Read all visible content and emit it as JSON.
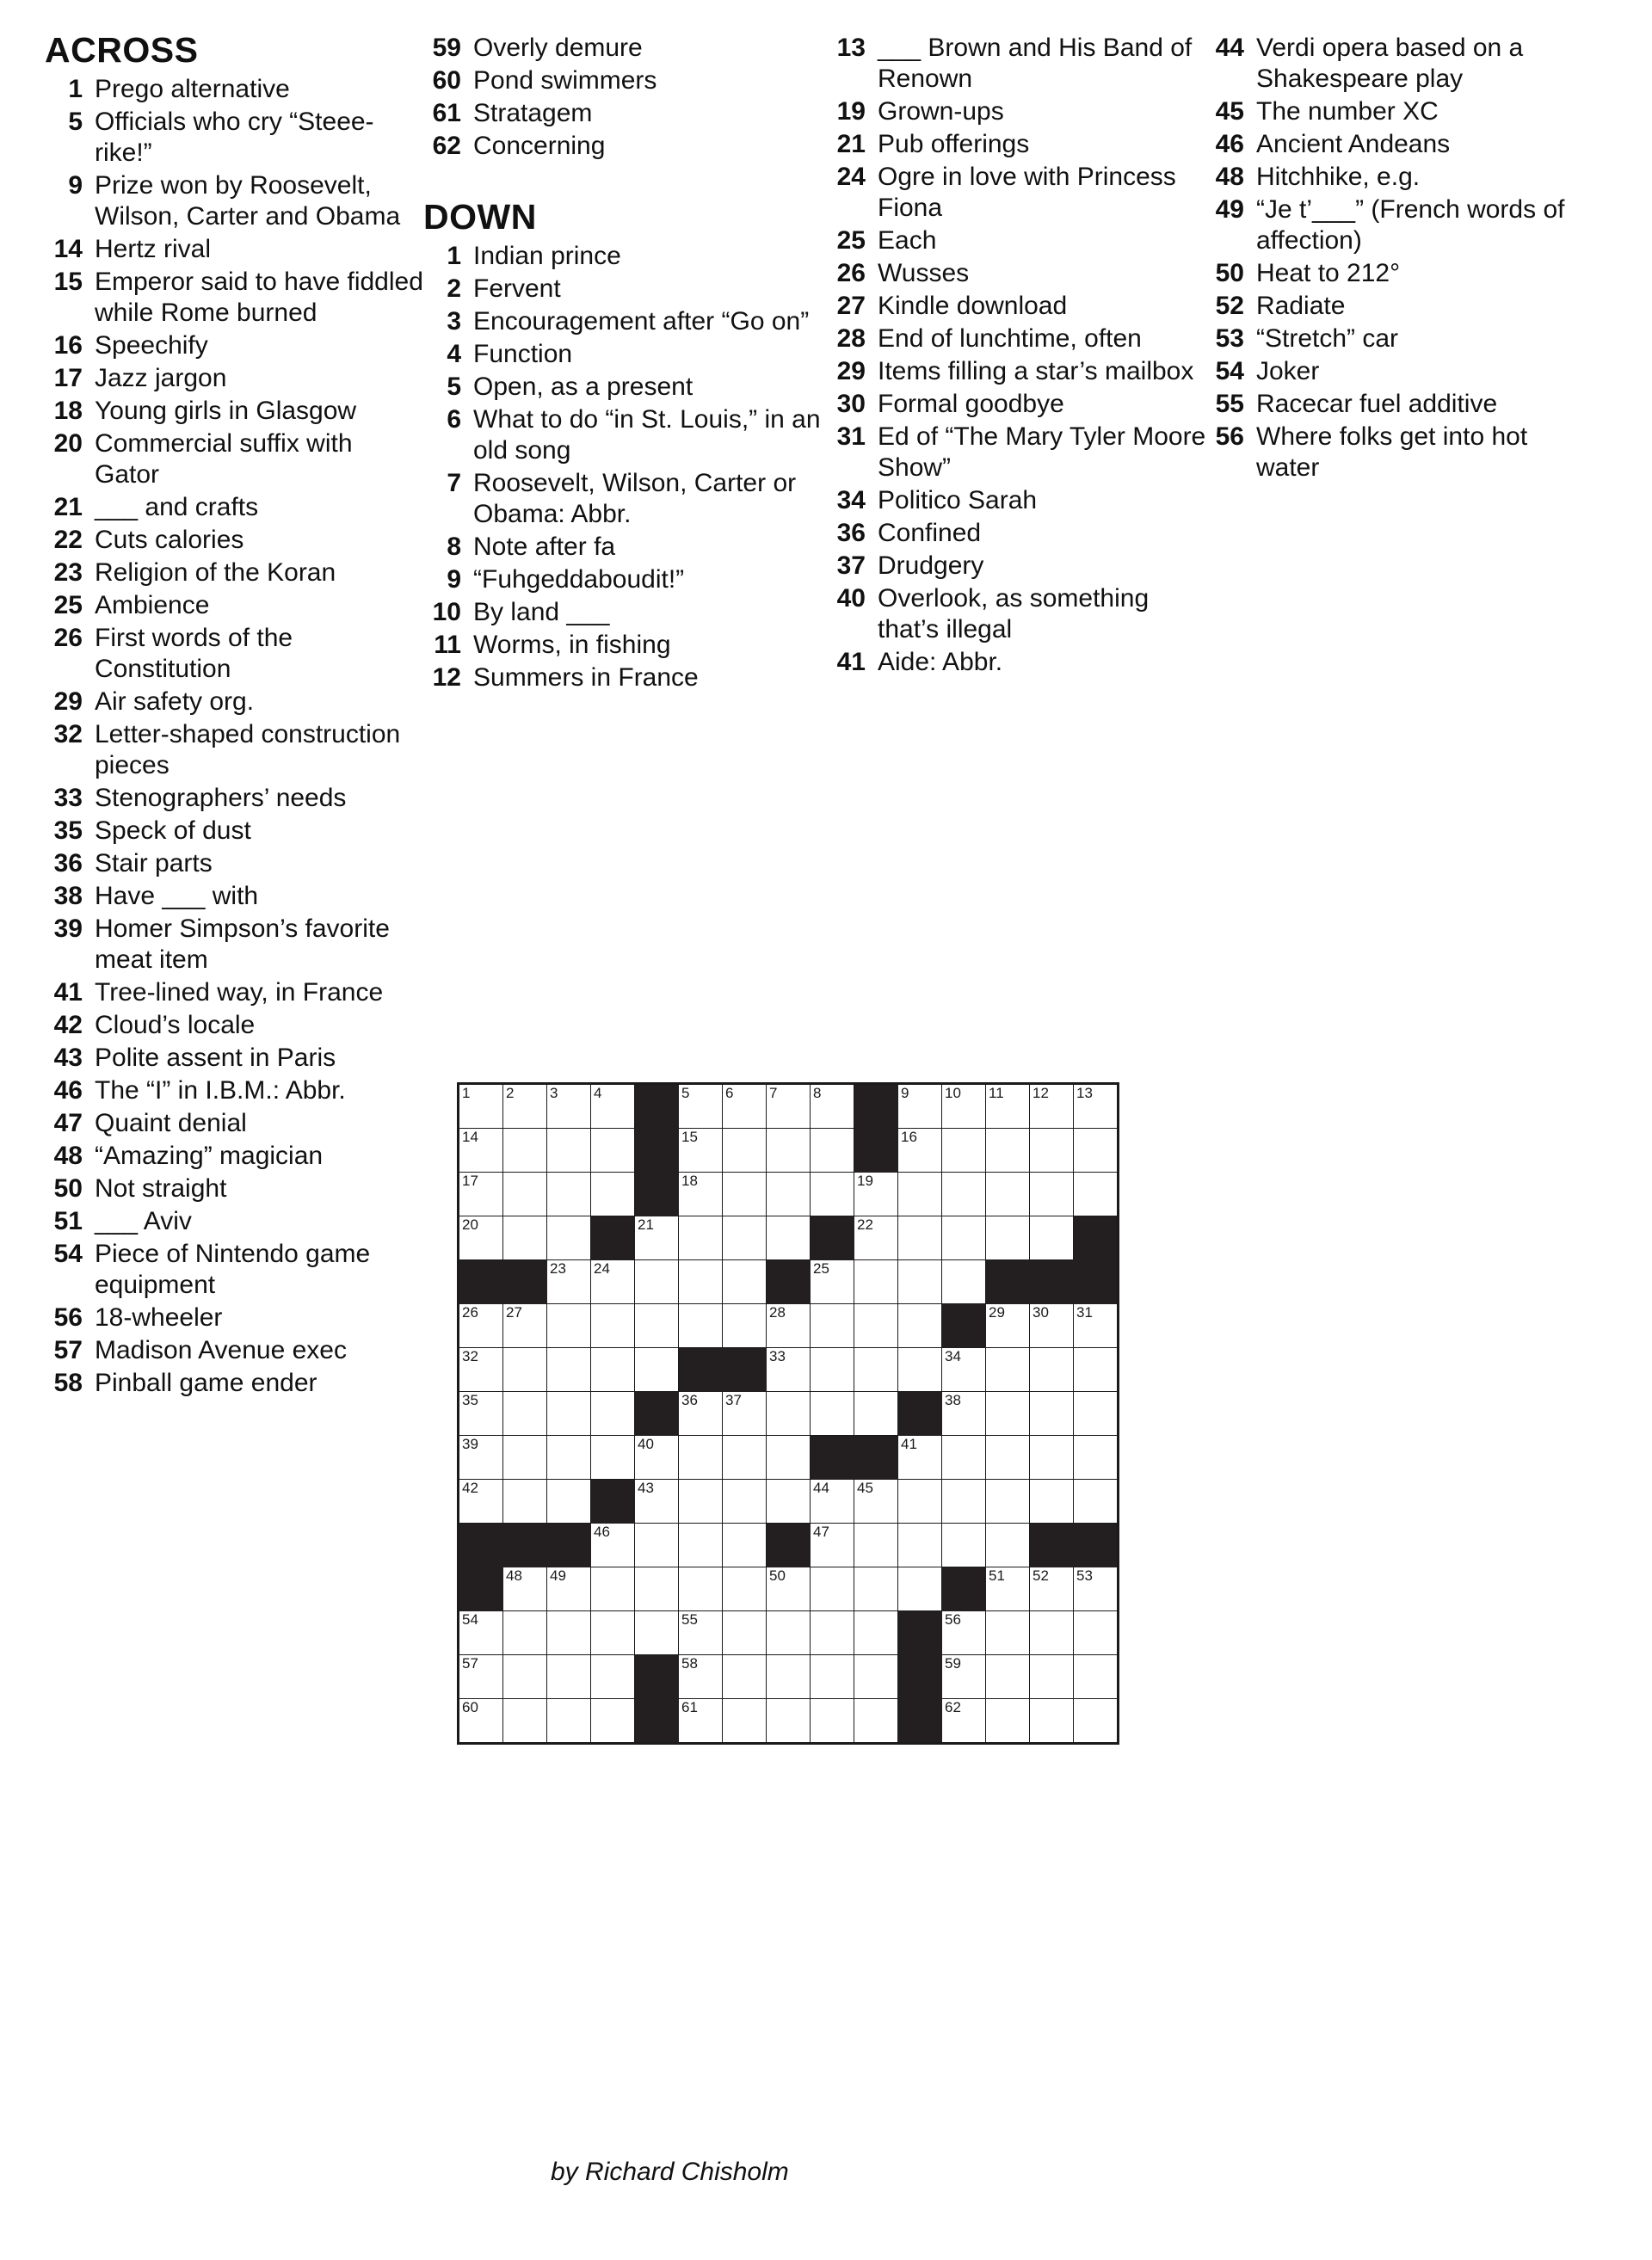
{
  "headings": {
    "across": "ACROSS",
    "down": "DOWN"
  },
  "byline": "by Richard Chisholm",
  "across": [
    {
      "n": "1",
      "clue": "Prego alternative"
    },
    {
      "n": "5",
      "clue": "Officials who cry “Steee-rike!”"
    },
    {
      "n": "9",
      "clue": "Prize won by Roosevelt, Wilson, Carter and Obama"
    },
    {
      "n": "14",
      "clue": "Hertz rival"
    },
    {
      "n": "15",
      "clue": "Emperor said to have fiddled while Rome burned"
    },
    {
      "n": "16",
      "clue": "Speechify"
    },
    {
      "n": "17",
      "clue": "Jazz jargon"
    },
    {
      "n": "18",
      "clue": "Young girls in Glasgow"
    },
    {
      "n": "20",
      "clue": "Commercial suffix with Gator"
    },
    {
      "n": "21",
      "clue": "___ and crafts"
    },
    {
      "n": "22",
      "clue": "Cuts calories"
    },
    {
      "n": "23",
      "clue": "Religion of the Koran"
    },
    {
      "n": "25",
      "clue": "Ambience"
    },
    {
      "n": "26",
      "clue": "First words of the Constitution"
    },
    {
      "n": "29",
      "clue": "Air safety org."
    },
    {
      "n": "32",
      "clue": "Letter-shaped construction pieces"
    },
    {
      "n": "33",
      "clue": "Stenographers’ needs"
    },
    {
      "n": "35",
      "clue": "Speck of dust"
    },
    {
      "n": "36",
      "clue": "Stair parts"
    },
    {
      "n": "38",
      "clue": "Have ___ with"
    },
    {
      "n": "39",
      "clue": "Homer Simpson’s favorite meat item"
    },
    {
      "n": "41",
      "clue": "Tree-lined way, in France"
    },
    {
      "n": "42",
      "clue": "Cloud’s locale"
    },
    {
      "n": "43",
      "clue": "Polite assent in Paris"
    },
    {
      "n": "46",
      "clue": "The “I” in I.B.M.: Abbr."
    },
    {
      "n": "47",
      "clue": "Quaint denial"
    },
    {
      "n": "48",
      "clue": "“Amazing” magician"
    },
    {
      "n": "50",
      "clue": "Not straight"
    },
    {
      "n": "51",
      "clue": "___ Aviv"
    },
    {
      "n": "54",
      "clue": "Piece of Nintendo game equipment"
    },
    {
      "n": "56",
      "clue": "18-wheeler"
    },
    {
      "n": "57",
      "clue": "Madison Avenue exec"
    },
    {
      "n": "58",
      "clue": "Pinball game ender"
    },
    {
      "n": "59",
      "clue": "Overly demure"
    },
    {
      "n": "60",
      "clue": "Pond swimmers"
    },
    {
      "n": "61",
      "clue": "Stratagem"
    },
    {
      "n": "62",
      "clue": "Concerning"
    }
  ],
  "down": [
    {
      "n": "1",
      "clue": "Indian prince"
    },
    {
      "n": "2",
      "clue": "Fervent"
    },
    {
      "n": "3",
      "clue": "Encouragement after “Go on”"
    },
    {
      "n": "4",
      "clue": "Function"
    },
    {
      "n": "5",
      "clue": "Open, as a present"
    },
    {
      "n": "6",
      "clue": "What to do “in St. Louis,” in an old song"
    },
    {
      "n": "7",
      "clue": "Roosevelt, Wilson, Carter or Obama: Abbr."
    },
    {
      "n": "8",
      "clue": "Note after fa"
    },
    {
      "n": "9",
      "clue": "“Fuhgeddaboudit!”"
    },
    {
      "n": "10",
      "clue": "By land ___"
    },
    {
      "n": "11",
      "clue": "Worms, in fishing"
    },
    {
      "n": "12",
      "clue": "Summers in France"
    },
    {
      "n": "13",
      "clue": "___ Brown and His Band of Renown"
    },
    {
      "n": "19",
      "clue": "Grown-ups"
    },
    {
      "n": "21",
      "clue": "Pub offerings"
    },
    {
      "n": "24",
      "clue": "Ogre in love with Princess Fiona"
    },
    {
      "n": "25",
      "clue": "Each"
    },
    {
      "n": "26",
      "clue": "Wusses"
    },
    {
      "n": "27",
      "clue": "Kindle download"
    },
    {
      "n": "28",
      "clue": "End of lunchtime, often"
    },
    {
      "n": "29",
      "clue": "Items filling a star’s mailbox"
    },
    {
      "n": "30",
      "clue": "Formal goodbye"
    },
    {
      "n": "31",
      "clue": "Ed of “The Mary Tyler Moore Show”"
    },
    {
      "n": "34",
      "clue": "Politico Sarah"
    },
    {
      "n": "36",
      "clue": "Confined"
    },
    {
      "n": "37",
      "clue": "Drudgery"
    },
    {
      "n": "40",
      "clue": "Overlook, as something that’s illegal"
    },
    {
      "n": "41",
      "clue": "Aide: Abbr."
    },
    {
      "n": "44",
      "clue": "Verdi opera based on a Shakespeare play"
    },
    {
      "n": "45",
      "clue": "The number XC"
    },
    {
      "n": "46",
      "clue": "Ancient Andeans"
    },
    {
      "n": "48",
      "clue": "Hitchhike, e.g."
    },
    {
      "n": "49",
      "clue": "“Je t’___” (French words of affection)"
    },
    {
      "n": "50",
      "clue": "Heat to 212°"
    },
    {
      "n": "52",
      "clue": "Radiate"
    },
    {
      "n": "53",
      "clue": "“Stretch” car"
    },
    {
      "n": "54",
      "clue": "Joker"
    },
    {
      "n": "55",
      "clue": "Racecar fuel additive"
    },
    {
      "n": "56",
      "clue": "Where folks get into hot water"
    }
  ],
  "column_split": {
    "col1": {
      "list": "across",
      "start": 0,
      "end": 33
    },
    "col2": {
      "list": "across",
      "start": 33,
      "end": 37
    },
    "col2_down": {
      "list": "down",
      "start": 0,
      "end": 12
    },
    "col3": {
      "list": "down",
      "start": 12,
      "end": 28
    },
    "col4": {
      "list": "down",
      "start": 28,
      "end": 39
    }
  },
  "grid": {
    "rows": 15,
    "cols": 15,
    "black_color": "#231f20",
    "white_color": "#ffffff",
    "cells": [
      [
        {
          "n": "1"
        },
        {
          "n": "2"
        },
        {
          "n": "3"
        },
        {
          "n": "4"
        },
        {
          "b": 1
        },
        {
          "n": "5"
        },
        {
          "n": "6"
        },
        {
          "n": "7"
        },
        {
          "n": "8"
        },
        {
          "b": 1
        },
        {
          "n": "9"
        },
        {
          "n": "10"
        },
        {
          "n": "11"
        },
        {
          "n": "12"
        },
        {
          "n": "13"
        }
      ],
      [
        {
          "n": "14"
        },
        {},
        {},
        {},
        {
          "b": 1
        },
        {
          "n": "15"
        },
        {},
        {},
        {},
        {
          "b": 1
        },
        {
          "n": "16"
        },
        {},
        {},
        {},
        {}
      ],
      [
        {
          "n": "17"
        },
        {},
        {},
        {},
        {
          "b": 1
        },
        {
          "n": "18"
        },
        {},
        {},
        {},
        {
          "n": "19"
        },
        {},
        {},
        {},
        {},
        {}
      ],
      [
        {
          "n": "20"
        },
        {},
        {},
        {
          "b": 1
        },
        {
          "n": "21"
        },
        {},
        {},
        {},
        {
          "b": 1
        },
        {
          "n": "22"
        },
        {},
        {},
        {},
        {},
        {
          "b": 1
        }
      ],
      [
        {
          "b": 1
        },
        {
          "b": 1
        },
        {
          "n": "23"
        },
        {
          "n": "24"
        },
        {},
        {},
        {},
        {
          "b": 1
        },
        {
          "n": "25"
        },
        {},
        {},
        {},
        {
          "b": 1
        },
        {
          "b": 1
        },
        {
          "b": 1
        }
      ],
      [
        {
          "n": "26"
        },
        {
          "n": "27"
        },
        {},
        {},
        {},
        {},
        {},
        {
          "n": "28"
        },
        {},
        {},
        {},
        {
          "b": 1
        },
        {
          "n": "29"
        },
        {
          "n": "30"
        },
        {
          "n": "31"
        }
      ],
      [
        {
          "n": "32"
        },
        {},
        {},
        {},
        {},
        {
          "b": 1
        },
        {
          "b": 1
        },
        {
          "n": "33"
        },
        {},
        {},
        {},
        {
          "n": "34"
        },
        {},
        {},
        {}
      ],
      [
        {
          "n": "35"
        },
        {},
        {},
        {},
        {
          "b": 1
        },
        {
          "n": "36"
        },
        {
          "n": "37"
        },
        {},
        {},
        {},
        {
          "b": 1
        },
        {
          "n": "38"
        },
        {},
        {},
        {}
      ],
      [
        {
          "n": "39"
        },
        {},
        {},
        {},
        {
          "n": "40"
        },
        {},
        {},
        {},
        {
          "b": 1
        },
        {
          "b": 1
        },
        {
          "n": "41"
        },
        {},
        {},
        {},
        {}
      ],
      [
        {
          "n": "42"
        },
        {},
        {},
        {
          "b": 1
        },
        {
          "n": "43"
        },
        {},
        {},
        {},
        {
          "n": "44"
        },
        {
          "n": "45"
        },
        {},
        {},
        {},
        {},
        {}
      ],
      [
        {
          "b": 1
        },
        {
          "b": 1
        },
        {
          "b": 1
        },
        {
          "n": "46"
        },
        {},
        {},
        {},
        {
          "b": 1
        },
        {
          "n": "47"
        },
        {},
        {},
        {},
        {},
        {
          "b": 1
        },
        {
          "b": 1
        }
      ],
      [
        {
          "b": 1
        },
        {
          "n": "48"
        },
        {
          "n": "49"
        },
        {},
        {},
        {},
        {},
        {
          "n": "50"
        },
        {},
        {},
        {},
        {
          "b": 1
        },
        {
          "n": "51"
        },
        {
          "n": "52"
        },
        {
          "n": "53"
        }
      ],
      [
        {
          "n": "54"
        },
        {},
        {},
        {},
        {},
        {
          "n": "55"
        },
        {},
        {},
        {},
        {},
        {
          "b": 1
        },
        {
          "n": "56"
        },
        {},
        {},
        {}
      ],
      [
        {
          "n": "57"
        },
        {},
        {},
        {},
        {
          "b": 1
        },
        {
          "n": "58"
        },
        {},
        {},
        {},
        {},
        {
          "b": 1
        },
        {
          "n": "59"
        },
        {},
        {},
        {}
      ],
      [
        {
          "n": "60"
        },
        {},
        {},
        {},
        {
          "b": 1
        },
        {
          "n": "61"
        },
        {},
        {},
        {},
        {},
        {
          "b": 1
        },
        {
          "n": "62"
        },
        {},
        {},
        {}
      ]
    ]
  }
}
